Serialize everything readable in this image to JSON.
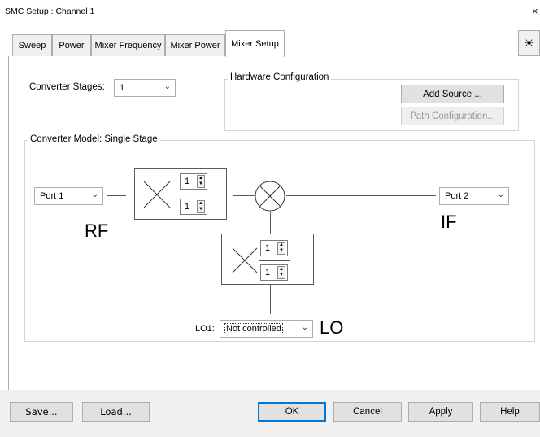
{
  "window": {
    "title": "SMC Setup : Channel 1",
    "close": "×"
  },
  "tabs": [
    {
      "label": "Sweep"
    },
    {
      "label": "Power"
    },
    {
      "label": "Mixer Frequency"
    },
    {
      "label": "Mixer Power"
    },
    {
      "label": "Mixer Setup"
    }
  ],
  "settings_icon": "☀",
  "converter_stages": {
    "label": "Converter Stages:",
    "value": "1"
  },
  "hardware": {
    "title": "Hardware Configuration",
    "add_source": "Add Source ...",
    "path_config": "Path Configuration..."
  },
  "model": {
    "title": "Converter Model: Single Stage",
    "port_in": "Port 1",
    "port_out": "Port 2",
    "rf_label": "RF",
    "if_label": "IF",
    "lo_label": "LO",
    "lo_field_label": "LO1:",
    "lo_value": "Not controlled",
    "mult_top": {
      "num": "1",
      "den": "1"
    },
    "mult_lo": {
      "num": "1",
      "den": "1"
    }
  },
  "footer": {
    "save": "Save...",
    "load": "Load...",
    "ok": "OK",
    "cancel": "Cancel",
    "apply": "Apply",
    "help": "Help"
  }
}
